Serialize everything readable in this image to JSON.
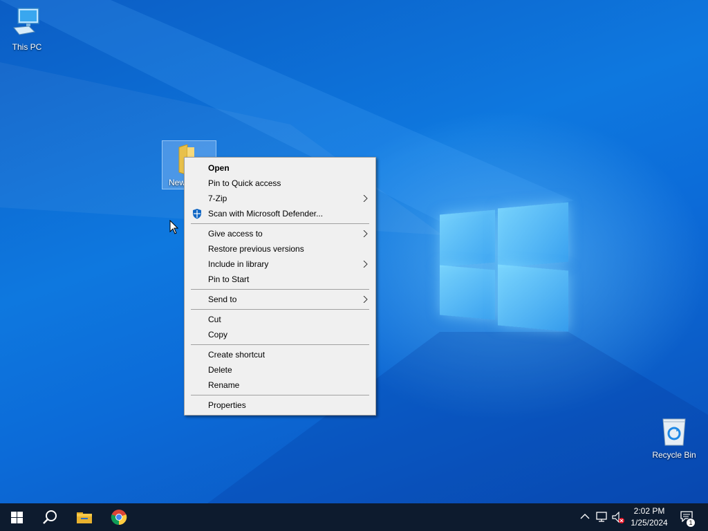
{
  "desktop": {
    "icons": {
      "this_pc": "This PC",
      "recycle_bin": "Recycle Bin",
      "folder_label": "New"
    }
  },
  "context_menu": {
    "items": [
      {
        "label": "Open",
        "bold": true,
        "submenu": false
      },
      {
        "label": "Pin to Quick access",
        "submenu": false
      },
      {
        "label": "7-Zip",
        "submenu": true
      },
      {
        "label": "Scan with Microsoft Defender...",
        "icon": "defender-shield-icon",
        "submenu": false
      },
      {
        "label": "Give access to",
        "submenu": true
      },
      {
        "label": "Restore previous versions",
        "submenu": false
      },
      {
        "label": "Include in library",
        "submenu": true
      },
      {
        "label": "Pin to Start",
        "submenu": false
      },
      {
        "label": "Send to",
        "submenu": true
      },
      {
        "label": "Cut",
        "submenu": false
      },
      {
        "label": "Copy",
        "submenu": false
      },
      {
        "label": "Create shortcut",
        "submenu": false
      },
      {
        "label": "Delete",
        "submenu": false
      },
      {
        "label": "Rename",
        "submenu": false
      },
      {
        "label": "Properties",
        "submenu": false
      }
    ]
  },
  "taskbar": {
    "apps": [
      "start-icon",
      "search-icon",
      "file-explorer-icon",
      "chrome-icon"
    ],
    "tray": {
      "time": "2:02 PM",
      "date": "1/25/2024",
      "notification_count": "1",
      "icons": [
        "chevron-up-icon",
        "network-icon",
        "volume-muted-icon",
        "action-center-icon"
      ]
    }
  },
  "colors": {
    "desktop_blue": "#0b6bd8",
    "taskbar": "#0d1b2e",
    "menu_bg": "#f0f0f0"
  }
}
